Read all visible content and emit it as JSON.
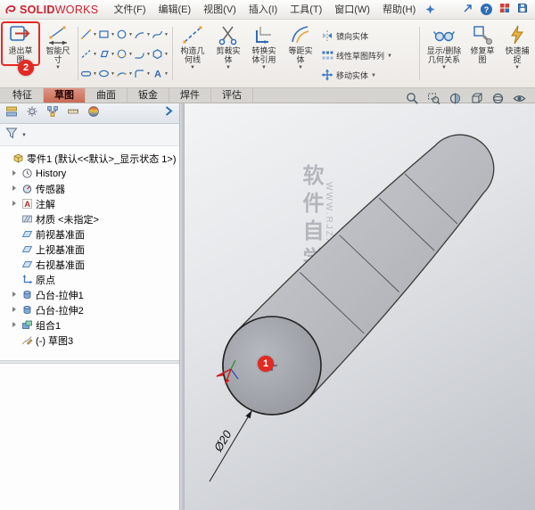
{
  "menubar": {
    "logo_bold": "SOLID",
    "logo_light": "WORKS",
    "menus": [
      "文件(F)",
      "编辑(E)",
      "视图(V)",
      "插入(I)",
      "工具(T)",
      "窗口(W)",
      "帮助(H)"
    ]
  },
  "ribbon": {
    "exit_sketch": "退出草图",
    "smart_dimension": "智能尺寸",
    "construction_geometry": "构造几何线",
    "trim_entities": "剪裁实体",
    "convert_entities": "转换实体引用",
    "offset_entities": "等距实体",
    "mirror_entities": "镜向实体",
    "linear_sketch_pattern": "线性草图阵列",
    "move_entities": "移动实体",
    "display_delete_relations": "显示/删除几何关系",
    "repair_sketch": "修复草图",
    "quick_snaps": "快速捕捉"
  },
  "tabs": [
    "特征",
    "草图",
    "曲面",
    "钣金",
    "焊件",
    "评估"
  ],
  "tree": [
    "零件1 (默认<<默认>_显示状态 1>)",
    "History",
    "传感器",
    "注解",
    "材质 <未指定>",
    "前视基准面",
    "上视基准面",
    "右视基准面",
    "原点",
    "凸台-拉伸1",
    "凸台-拉伸2",
    "组合1",
    "(-) 草图3"
  ],
  "viewport": {
    "dimension": "Ø20",
    "watermark_name": "软件自学网",
    "watermark_url": "WWW.RJZXW.COM"
  },
  "annotations": {
    "badge1": "1",
    "badge2": "2"
  },
  "icons": {
    "caret": "▼",
    "question_glyph": "?",
    "letter_a_glyph": "A"
  },
  "colors": {
    "brand_red": "#cf1f2e",
    "annotation_red": "#e22a22",
    "active_tab": "#c96a55"
  }
}
